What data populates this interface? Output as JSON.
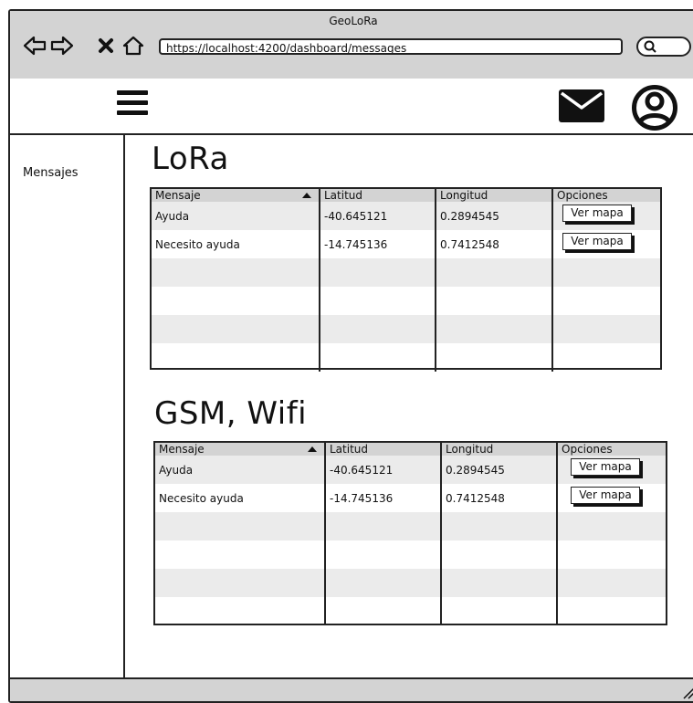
{
  "window": {
    "title": "GeoLoRa"
  },
  "browser": {
    "url": "https://localhost:4200/dashboard/messages"
  },
  "sidebar": {
    "items": [
      {
        "label": "Mensajes"
      }
    ]
  },
  "columns": [
    "Mensaje",
    "Latitud",
    "Longitud",
    "Opciones"
  ],
  "sections": [
    {
      "title": "LoRa",
      "rows": [
        {
          "mensaje": "Ayuda",
          "latitud": "-40.645121",
          "longitud": "0.2894545",
          "action": "Ver mapa"
        },
        {
          "mensaje": "Necesito ayuda",
          "latitud": "-14.745136",
          "longitud": "0.7412548",
          "action": "Ver mapa"
        }
      ]
    },
    {
      "title": "GSM, Wifi",
      "rows": [
        {
          "mensaje": "Ayuda",
          "latitud": "-40.645121",
          "longitud": "0.2894545",
          "action": "Ver mapa"
        },
        {
          "mensaje": "Necesito ayuda",
          "latitud": "-14.745136",
          "longitud": "0.7412548",
          "action": "Ver mapa"
        }
      ]
    }
  ],
  "icons": {
    "back": "back-arrow-icon",
    "forward": "forward-arrow-icon",
    "stop": "close-icon",
    "home": "home-icon",
    "search": "search-icon",
    "menu": "hamburger-menu-icon",
    "mail": "mail-icon",
    "user": "user-avatar-icon"
  },
  "colors": {
    "chrome": "#d3d3d3",
    "row_alt": "#ebebeb",
    "ink": "#111111"
  }
}
